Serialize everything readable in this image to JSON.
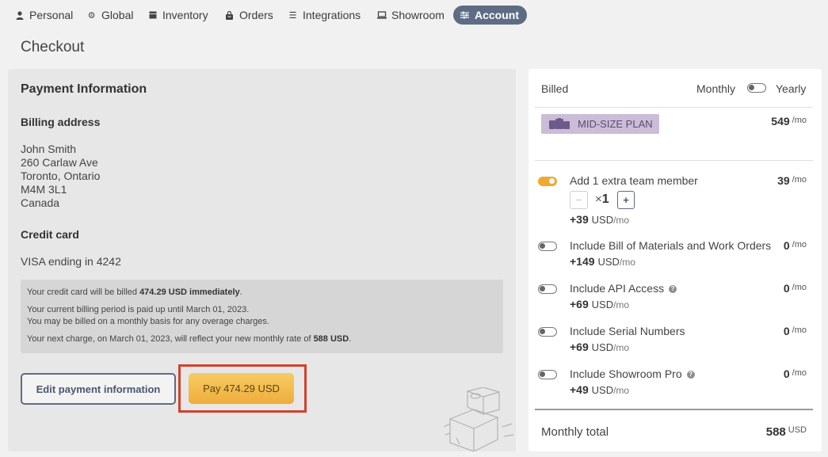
{
  "nav": {
    "items": [
      {
        "label": "Personal",
        "icon": "person-icon"
      },
      {
        "label": "Global",
        "icon": "gear-icon"
      },
      {
        "label": "Inventory",
        "icon": "box-icon"
      },
      {
        "label": "Orders",
        "icon": "bag-icon"
      },
      {
        "label": "Integrations",
        "icon": "list-icon"
      },
      {
        "label": "Showroom",
        "icon": "monitor-icon"
      },
      {
        "label": "Account",
        "icon": "sliders-icon",
        "active": true
      }
    ]
  },
  "page": {
    "title": "Checkout"
  },
  "payment": {
    "heading": "Payment Information",
    "billing_heading": "Billing address",
    "address": [
      "John Smith",
      "260 Carlaw Ave",
      "Toronto, Ontario",
      "M4M 3L1",
      "Canada"
    ],
    "cc_heading": "Credit card",
    "cc_text": "VISA ending in 4242",
    "notice": {
      "l1_pre": "Your credit card will be billed ",
      "l1_bold": "474.29 USD immediately",
      "l1_post": ".",
      "l2": "Your current billing period is paid up until March 01, 2023.",
      "l3": "You may be billed on a monthly basis for any overage charges.",
      "l4_pre": "Your next charge, on March 01, 2023, will reflect your new monthly rate of ",
      "l4_bold": "588 USD",
      "l4_post": "."
    },
    "edit_label": "Edit payment information",
    "pay_label": "Pay 474.29 USD"
  },
  "summary": {
    "billed_label": "Billed",
    "period_monthly": "Monthly",
    "period_yearly": "Yearly",
    "period_selected": "Monthly",
    "plan": {
      "name": "MID-SIZE PLAN",
      "price": "549",
      "per": "/mo"
    },
    "options": [
      {
        "label": "Add 1 extra team member",
        "price": "39",
        "per": "/mo",
        "cost": "+39",
        "unit": "USD",
        "cost_per": "/mo",
        "enabled": true,
        "help": false,
        "quantity": "1"
      },
      {
        "label": "Include Bill of Materials and Work Orders",
        "price": "0",
        "per": "/mo",
        "cost": "+149",
        "unit": "USD",
        "cost_per": "/mo",
        "enabled": false,
        "help": false
      },
      {
        "label": "Include API Access",
        "price": "0",
        "per": "/mo",
        "cost": "+69",
        "unit": "USD",
        "cost_per": "/mo",
        "enabled": false,
        "help": true
      },
      {
        "label": "Include Serial Numbers",
        "price": "0",
        "per": "/mo",
        "cost": "+69",
        "unit": "USD",
        "cost_per": "/mo",
        "enabled": false,
        "help": false
      },
      {
        "label": "Include Showroom Pro",
        "price": "0",
        "per": "/mo",
        "cost": "+49",
        "unit": "USD",
        "cost_per": "/mo",
        "enabled": false,
        "help": true
      }
    ],
    "stepper": {
      "minus": "−",
      "times": "×",
      "plus": "+"
    },
    "help_glyph": "?",
    "total_label": "Monthly total",
    "total_value": "588",
    "total_unit": "USD"
  },
  "colors": {
    "accent": "#5e6b84",
    "pay": "#f0b040",
    "highlight": "#d2412d",
    "plan_badge": "#cbbdd8"
  }
}
